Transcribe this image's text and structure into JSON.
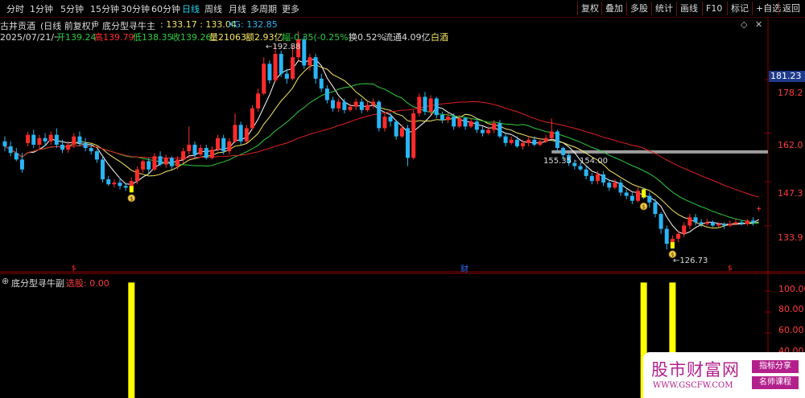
{
  "toolbar": {
    "periods": [
      "分时",
      "1分钟",
      "5分钟",
      "15分钟",
      "30分钟",
      "60分钟",
      "日线",
      "周线",
      "月线",
      "多周期",
      "更多"
    ],
    "active_period": "日线",
    "right_buttons": [
      "复权",
      "叠加",
      "多股",
      "统计",
      "画线",
      "F10",
      "标记",
      "+自选",
      "返回"
    ]
  },
  "stock": {
    "name": "古井贡酒",
    "mode": "(日线 前复权)",
    "indicator_name": "底分型寻牛主",
    "indicator_values": ": 133.17 : 133.04",
    "xg": "XG: 132.85"
  },
  "quote": {
    "date": "2025/07/21/一",
    "open": "开139.24",
    "high": "高139.79",
    "low": "低138.35",
    "close": "收139.26",
    "volume": "量21063",
    "amount": "额2.93亿",
    "change": "幅-0.35(-0.25%)",
    "turnover": "换0.52%",
    "float": "流通4.09亿",
    "sector": "白酒"
  },
  "annotations": {
    "high_label": "192.88",
    "low_label": "126.73",
    "range_label": "155.35 - 154.00",
    "financial_marker": "财",
    "signal_marker": "$"
  },
  "price_axis": {
    "ticks": [
      "178.2",
      "162.0",
      "147.3",
      "133.9"
    ],
    "current_price": "181.23"
  },
  "sub_panel": {
    "title": "底分型寻牛副",
    "select_label": "选股: 0.00",
    "ticks": [
      "100.00",
      "80.00",
      "60.00",
      "40.00"
    ]
  },
  "watermark": {
    "title": "股市财富网",
    "url": "WWW.GSCFW.COM",
    "tag1": "指标分享",
    "tag2": "名师课程"
  },
  "colors": {
    "up": "#ff2b2b",
    "down": "#29b6f6",
    "ma5": "#ffffff",
    "ma10": "#f5e663",
    "ma20": "#2ecc40",
    "ma60": "#e02020",
    "signal_bar": "#ffff00",
    "axis_red": "#8b0000",
    "accent_cyan": "#22d3ee"
  },
  "chart_data": {
    "type": "candlestick",
    "price_range": [
      120.0,
      196.0
    ],
    "y_ticks": [
      178.2,
      162.0,
      147.3,
      133.9
    ],
    "candles": [
      [
        159.5,
        158.0,
        161.0,
        156.5
      ],
      [
        158.0,
        156.0,
        159.5,
        155.0
      ],
      [
        156.0,
        154.0,
        157.5,
        153.5
      ],
      [
        154.0,
        151.0,
        156.0,
        150.0
      ],
      [
        159.0,
        161.5,
        162.5,
        158.0
      ],
      [
        161.5,
        158.5,
        163.0,
        157.5
      ],
      [
        158.5,
        160.5,
        161.5,
        157.0
      ],
      [
        160.5,
        159.5,
        162.0,
        158.0
      ],
      [
        159.5,
        161.5,
        162.5,
        158.5
      ],
      [
        161.5,
        158.5,
        163.5,
        157.5
      ],
      [
        158.5,
        157.0,
        160.0,
        156.0
      ],
      [
        157.0,
        158.5,
        159.5,
        156.0
      ],
      [
        158.5,
        161.0,
        162.0,
        157.5
      ],
      [
        161.0,
        159.0,
        162.5,
        158.0
      ],
      [
        159.0,
        157.5,
        160.5,
        156.5
      ],
      [
        157.5,
        156.5,
        158.5,
        155.5
      ],
      [
        156.5,
        154.0,
        157.0,
        153.0
      ],
      [
        154.0,
        148.0,
        155.0,
        147.0
      ],
      [
        148.0,
        146.5,
        149.0,
        146.0
      ],
      [
        146.5,
        147.0,
        148.0,
        145.5
      ],
      [
        147.0,
        146.0,
        148.5,
        145.0
      ],
      [
        146.0,
        145.5,
        147.0,
        144.5
      ],
      [
        145.5,
        147.5,
        148.5,
        144.5
      ],
      [
        147.5,
        151.0,
        152.0,
        146.5
      ],
      [
        151.0,
        153.5,
        154.0,
        150.0
      ],
      [
        153.5,
        151.0,
        154.5,
        150.0
      ],
      [
        151.0,
        155.0,
        156.0,
        150.5
      ],
      [
        155.0,
        152.5,
        156.5,
        152.0
      ],
      [
        152.5,
        154.5,
        155.5,
        151.5
      ],
      [
        154.5,
        152.0,
        155.0,
        151.0
      ],
      [
        152.0,
        154.0,
        155.0,
        151.0
      ],
      [
        154.0,
        156.5,
        157.5,
        153.0
      ],
      [
        156.5,
        158.5,
        164.0,
        155.5
      ],
      [
        158.5,
        155.5,
        159.5,
        154.5
      ],
      [
        155.5,
        157.5,
        158.5,
        155.0
      ],
      [
        157.5,
        154.5,
        158.5,
        154.0
      ],
      [
        154.5,
        157.0,
        158.0,
        154.0
      ],
      [
        157.0,
        160.5,
        161.5,
        156.5
      ],
      [
        160.5,
        156.5,
        161.5,
        155.5
      ],
      [
        156.5,
        159.5,
        160.5,
        155.5
      ],
      [
        159.5,
        164.5,
        168.0,
        159.0
      ],
      [
        164.5,
        159.5,
        165.5,
        158.5
      ],
      [
        159.5,
        163.5,
        164.5,
        159.0
      ],
      [
        163.5,
        169.5,
        170.5,
        163.0
      ],
      [
        169.5,
        174.0,
        175.5,
        168.5
      ],
      [
        174.0,
        183.0,
        185.0,
        173.5
      ],
      [
        183.0,
        178.0,
        184.0,
        177.0
      ],
      [
        178.0,
        186.0,
        189.0,
        177.5
      ],
      [
        186.0,
        180.0,
        187.0,
        179.0
      ],
      [
        180.0,
        178.5,
        181.5,
        177.0
      ],
      [
        178.5,
        185.0,
        188.5,
        178.0
      ],
      [
        185.0,
        190.5,
        192.88,
        184.0
      ],
      [
        190.5,
        182.5,
        191.5,
        181.5
      ],
      [
        182.5,
        185.0,
        186.0,
        181.0
      ],
      [
        185.0,
        178.5,
        186.0,
        177.0
      ],
      [
        178.5,
        175.5,
        180.0,
        174.5
      ],
      [
        175.5,
        172.0,
        176.5,
        171.0
      ],
      [
        172.0,
        169.5,
        173.0,
        168.5
      ],
      [
        169.5,
        171.5,
        172.5,
        168.5
      ],
      [
        171.5,
        169.0,
        172.5,
        168.0
      ],
      [
        169.0,
        170.0,
        171.0,
        168.5
      ],
      [
        170.0,
        171.5,
        172.5,
        169.0
      ],
      [
        171.5,
        169.0,
        172.5,
        168.0
      ],
      [
        169.0,
        170.5,
        171.5,
        168.5
      ],
      [
        170.5,
        171.5,
        172.5,
        169.5
      ],
      [
        171.5,
        163.5,
        172.0,
        162.5
      ],
      [
        163.5,
        167.0,
        168.0,
        162.5
      ],
      [
        167.0,
        165.5,
        168.0,
        164.0
      ],
      [
        165.5,
        161.0,
        166.0,
        160.0
      ],
      [
        161.0,
        163.5,
        164.5,
        160.5
      ],
      [
        163.5,
        154.5,
        164.5,
        152.0
      ],
      [
        154.5,
        168.0,
        169.0,
        154.0
      ],
      [
        168.0,
        173.0,
        174.0,
        167.0
      ],
      [
        173.0,
        168.5,
        174.5,
        167.5
      ],
      [
        168.5,
        172.5,
        173.5,
        167.5
      ],
      [
        172.5,
        167.5,
        173.0,
        166.5
      ],
      [
        167.5,
        166.0,
        168.5,
        165.0
      ],
      [
        166.0,
        167.0,
        168.0,
        165.0
      ],
      [
        167.0,
        164.0,
        168.0,
        163.0
      ],
      [
        164.0,
        166.5,
        167.5,
        163.5
      ],
      [
        166.5,
        164.0,
        167.0,
        163.0
      ],
      [
        164.0,
        165.5,
        166.5,
        163.5
      ],
      [
        165.5,
        163.0,
        166.5,
        162.0
      ],
      [
        163.0,
        162.0,
        164.0,
        161.0
      ],
      [
        162.0,
        163.0,
        164.0,
        161.5
      ],
      [
        163.0,
        165.0,
        166.0,
        162.0
      ],
      [
        165.0,
        161.0,
        166.0,
        160.5
      ],
      [
        161.0,
        159.0,
        162.0,
        158.0
      ],
      [
        159.0,
        160.0,
        161.0,
        158.5
      ],
      [
        160.0,
        158.0,
        161.0,
        157.5
      ],
      [
        158.0,
        159.0,
        160.0,
        157.0
      ],
      [
        159.0,
        160.0,
        161.0,
        158.0
      ],
      [
        160.0,
        158.5,
        161.0,
        158.0
      ],
      [
        158.5,
        159.5,
        160.5,
        158.0
      ],
      [
        159.5,
        160.5,
        161.5,
        159.0
      ],
      [
        160.5,
        162.5,
        166.5,
        160.0
      ],
      [
        162.5,
        157.5,
        163.0,
        156.5
      ],
      [
        157.5,
        155.35,
        158.0,
        154.0
      ],
      [
        155.35,
        153.0,
        156.0,
        152.0
      ],
      [
        153.0,
        152.0,
        154.0,
        151.0
      ],
      [
        152.0,
        151.0,
        153.0,
        150.5
      ],
      [
        151.0,
        149.0,
        152.0,
        148.0
      ],
      [
        149.0,
        147.5,
        150.0,
        146.5
      ],
      [
        147.5,
        149.5,
        150.5,
        146.5
      ],
      [
        149.5,
        147.0,
        150.5,
        146.0
      ],
      [
        147.0,
        145.5,
        148.0,
        144.5
      ],
      [
        145.5,
        147.0,
        148.0,
        145.0
      ],
      [
        147.0,
        144.0,
        148.0,
        143.0
      ],
      [
        144.0,
        143.0,
        145.0,
        142.0
      ],
      [
        143.0,
        141.5,
        144.0,
        140.5
      ],
      [
        141.5,
        144.5,
        145.5,
        141.0
      ],
      [
        144.5,
        143.0,
        145.5,
        142.0
      ],
      [
        143.0,
        141.0,
        144.0,
        139.5
      ],
      [
        141.0,
        137.5,
        142.0,
        136.5
      ],
      [
        137.5,
        133.0,
        138.0,
        131.5
      ],
      [
        133.0,
        128.5,
        134.0,
        126.73
      ],
      [
        128.5,
        130.0,
        131.0,
        127.5
      ],
      [
        130.0,
        131.5,
        132.5,
        129.0
      ],
      [
        131.5,
        134.0,
        135.0,
        130.5
      ],
      [
        134.0,
        136.5,
        137.5,
        133.0
      ],
      [
        136.5,
        135.0,
        137.5,
        134.0
      ],
      [
        135.0,
        134.5,
        136.0,
        133.5
      ],
      [
        134.5,
        135.0,
        136.0,
        134.0
      ],
      [
        135.0,
        134.0,
        135.5,
        133.5
      ],
      [
        134.0,
        134.5,
        135.0,
        133.5
      ],
      [
        134.5,
        134.0,
        135.0,
        133.0
      ],
      [
        134.0,
        134.5,
        135.5,
        133.5
      ],
      [
        134.5,
        135.0,
        136.0,
        134.0
      ],
      [
        135.0,
        134.5,
        135.5,
        134.0
      ],
      [
        134.5,
        135.5,
        136.0,
        134.0
      ],
      [
        135.5,
        134.8,
        136.5,
        134.0
      ],
      [
        139.24,
        139.26,
        139.79,
        138.35
      ]
    ],
    "signals": [
      22,
      111,
      116
    ],
    "sub_ylim": [
      0,
      110
    ],
    "sub_values": [
      100,
      100,
      100
    ]
  }
}
